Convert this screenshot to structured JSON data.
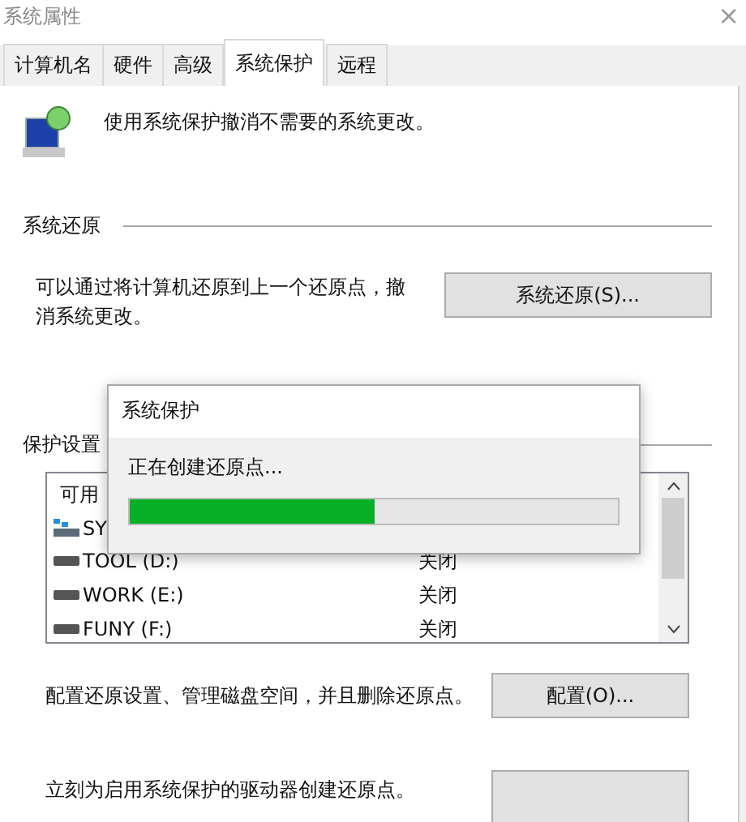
{
  "window": {
    "title": "系统属性",
    "close": "×"
  },
  "tabs": [
    {
      "label": "计算机名",
      "selected": false
    },
    {
      "label": "硬件",
      "selected": false
    },
    {
      "label": "高级",
      "selected": false
    },
    {
      "label": "系统保护",
      "selected": true
    },
    {
      "label": "远程",
      "selected": false
    }
  ],
  "intro": "使用系统保护撤消不需要的系统更改。",
  "restore": {
    "heading": "系统还原",
    "text": "可以通过将计算机还原到上一个还原点，撤消系统更改。",
    "button": "系统还原(S)..."
  },
  "protection": {
    "heading": "保护设置",
    "column_1": "可用",
    "drives": [
      {
        "name": "SY",
        "kind": "system"
      },
      {
        "name": "TOOL (D:)",
        "state": "关闭",
        "kind": "disk"
      },
      {
        "name": "WORK (E:)",
        "state": "关闭",
        "kind": "disk"
      },
      {
        "name": "FUNY (F:)",
        "state": "关闭",
        "kind": "disk"
      }
    ],
    "configure_text": "配置还原设置、管理磁盘空间，并且删除还原点。",
    "configure_button": "配置(O)...",
    "create_text": "立刻为启用系统保护的驱动器创建还原点。"
  },
  "dialog": {
    "title": "系统保护",
    "message": "正在创建还原点...",
    "level": 0.5
  }
}
